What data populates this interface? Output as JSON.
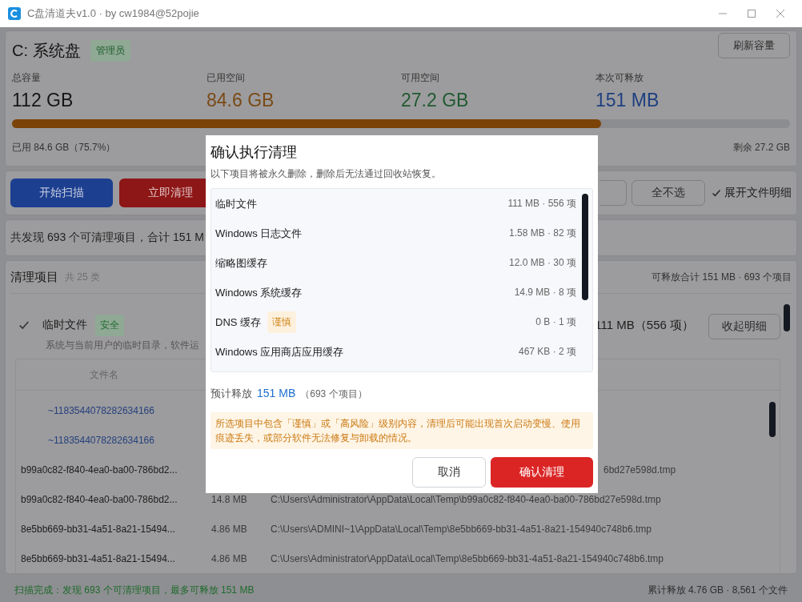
{
  "window": {
    "title": "C盘清道夫v1.0 · by cw1984@52pojie"
  },
  "disk": {
    "name": "C: 系统盘",
    "badge": "管理员",
    "refresh_button": "刷新容量",
    "stats": [
      {
        "label": "总容量",
        "value": "112 GB",
        "kind": "total"
      },
      {
        "label": "已用空间",
        "value": "84.6 GB",
        "kind": "used"
      },
      {
        "label": "可用空间",
        "value": "27.2 GB",
        "kind": "free"
      },
      {
        "label": "本次可释放",
        "value": "151 MB",
        "kind": "release"
      }
    ],
    "usage": {
      "level": 0.757
    },
    "used_text": "已用 84.6 GB（75.7%）",
    "free_text": "剩余 27.2 GB"
  },
  "actions": {
    "scan_button": "开始扫描",
    "clean_button": "立即清理",
    "deselect_button": "全不选",
    "expand_details": {
      "label": "展开文件明细",
      "checked": true
    }
  },
  "summary": "共发现 693 个可清理项目，合计 151 M",
  "items_panel": {
    "title": "清理项目",
    "count": "共 25 类",
    "total": "可释放合计 151 MB · 693 个项目",
    "item": {
      "checked": true,
      "name": "临时文件",
      "tag": {
        "label": "安全",
        "kind": "safe"
      },
      "size": "111 MB（556 项）",
      "toggle_button": "收起明细",
      "description": "系统与当前用户的临时目录，软件运"
    },
    "table": {
      "columns": [
        "文件名"
      ],
      "rows": [
        {
          "kind": "child",
          "name": "~1183544078282634166"
        },
        {
          "kind": "child",
          "name": "~1183544078282634166"
        },
        {
          "kind": "file",
          "name": "b99a0c82-f840-4ea0-ba00-786bd2...",
          "path": "6bd27e598d.tmp"
        },
        {
          "kind": "file",
          "name": "b99a0c82-f840-4ea0-ba00-786bd2...",
          "size": "14.8 MB",
          "path": "C:\\Users\\Administrator\\AppData\\Local\\Temp\\b99a0c82-f840-4ea0-ba00-786bd27e598d.tmp"
        },
        {
          "kind": "file",
          "name": "8e5bb669-bb31-4a51-8a21-15494...",
          "size": "4.86 MB",
          "path": "C:\\Users\\ADMINI~1\\AppData\\Local\\Temp\\8e5bb669-bb31-4a51-8a21-154940c748b6.tmp"
        },
        {
          "kind": "file",
          "name": "8e5bb669-bb31-4a51-8a21-15494...",
          "size": "4.86 MB",
          "path": "C:\\Users\\Administrator\\AppData\\Local\\Temp\\8e5bb669-bb31-4a51-8a21-154940c748b6.tmp"
        }
      ]
    }
  },
  "status_bar": {
    "message": "扫描完成：发现 693 个可清理项目，最多可释放 151 MB",
    "total": "累计释放 4.76 GB · 8,561 个文件"
  },
  "dialog": {
    "title": "确认执行清理",
    "subtitle": "以下项目将被永久删除，删除后无法通过回收站恢复。",
    "items": [
      {
        "name": "临时文件",
        "meta": "111 MB · 556 项"
      },
      {
        "name": "Windows 日志文件",
        "meta": "1.58 MB · 82 项"
      },
      {
        "name": "缩略图缓存",
        "meta": "12.0 MB · 30 项"
      },
      {
        "name": "Windows 系统缓存",
        "meta": "14.9 MB · 8 项"
      },
      {
        "name": "DNS 缓存",
        "meta": "0 B · 1 项",
        "tag": {
          "label": "谨慎",
          "kind": "caution"
        }
      },
      {
        "name": "Windows 应用商店应用缓存",
        "meta": "467 KB · 2 项"
      }
    ],
    "estimate": {
      "label": "预计释放",
      "value": "151 MB",
      "count": "（693 个项目）"
    },
    "warning": "所选项目中包含「谨慎」或「高风险」级别内容，清理后可能出现首次启动变慢、使用痕迹丢失，或部分软件无法修复与卸载的情况。",
    "cancel_button": "取消",
    "confirm_button": "确认清理"
  }
}
